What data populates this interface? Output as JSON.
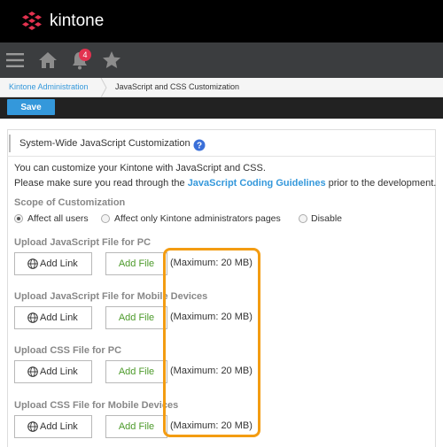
{
  "app": {
    "brand": "kintone"
  },
  "nav": {
    "notification_count": "4"
  },
  "breadcrumb": {
    "parent": "Kintone Administration",
    "current": "JavaScript and CSS Customization"
  },
  "toolbar": {
    "save_label": "Save"
  },
  "section": {
    "title": "System-Wide JavaScript Customization"
  },
  "description": {
    "line1": "You can customize your Kintone with JavaScript and CSS.",
    "line2_prefix": "Please make sure you read through the",
    "line2_link": "JavaScript Coding Guidelines",
    "line2_suffix": "prior to the development."
  },
  "scope": {
    "label": "Scope of Customization",
    "options": [
      "Affect all users",
      "Affect only Kintone administrators pages",
      "Disable"
    ],
    "selected": "Affect all users"
  },
  "uploads": [
    {
      "label": "Upload JavaScript File for PC",
      "link_label": "Add Link",
      "file_label": "Add File",
      "max_text": "(Maximum: 20 MB)"
    },
    {
      "label": "Upload JavaScript File for Mobile Devices",
      "link_label": "Add Link",
      "file_label": "Add File",
      "max_text": "(Maximum: 20 MB)"
    },
    {
      "label": "Upload CSS File for PC",
      "link_label": "Add Link",
      "file_label": "Add File",
      "max_text": "(Maximum: 20 MB)"
    },
    {
      "label": "Upload CSS File for Mobile Devices",
      "link_label": "Add Link",
      "file_label": "Add File",
      "max_text": "(Maximum: 20 MB)"
    }
  ],
  "colors": {
    "header_bg": "#000000",
    "navbar_bg": "#3b3d3f",
    "accent": "#3498db",
    "add_file_text": "#4c9a2a",
    "highlight": "#f39c12",
    "logo": "#e2324f"
  },
  "icons": {
    "logo": "kintone-logo-icon",
    "menu": "hamburger-menu-icon",
    "home": "home-icon",
    "bell": "bell-icon",
    "star": "star-icon",
    "help": "help-icon",
    "globe": "globe-icon"
  }
}
